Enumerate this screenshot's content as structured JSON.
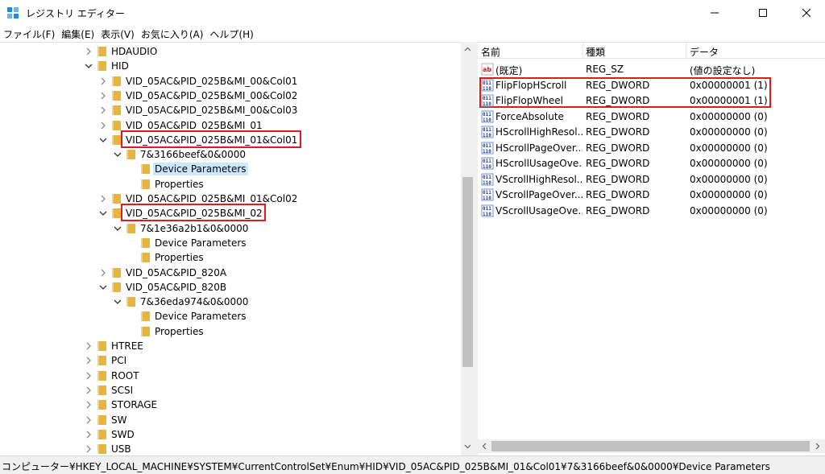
{
  "window": {
    "title": "レジストリ エディター",
    "icon": "registry-editor-icon"
  },
  "menu": [
    "ファイル(F)",
    "編集(E)",
    "表示(V)",
    "お気に入り(A)",
    "ヘルプ(H)"
  ],
  "tree": [
    {
      "label": "HDAUDIO",
      "level": 0,
      "state": "collapsed"
    },
    {
      "label": "HID",
      "level": 0,
      "state": "expanded"
    },
    {
      "label": "VID_05AC&PID_025B&MI_00&Col01",
      "level": 1,
      "state": "collapsed"
    },
    {
      "label": "VID_05AC&PID_025B&MI_00&Col02",
      "level": 1,
      "state": "collapsed"
    },
    {
      "label": "VID_05AC&PID_025B&MI_00&Col03",
      "level": 1,
      "state": "collapsed"
    },
    {
      "label": "VID_05AC&PID_025B&MI_01",
      "level": 1,
      "state": "collapsed"
    },
    {
      "label": "VID_05AC&PID_025B&MI_01&Col01",
      "level": 1,
      "state": "expanded",
      "highlight": true
    },
    {
      "label": "7&3166beef&0&0000",
      "level": 2,
      "state": "expanded"
    },
    {
      "label": "Device Parameters",
      "level": 3,
      "state": "none",
      "selected": true
    },
    {
      "label": "Properties",
      "level": 3,
      "state": "none"
    },
    {
      "label": "VID_05AC&PID_025B&MI_01&Col02",
      "level": 1,
      "state": "collapsed"
    },
    {
      "label": "VID_05AC&PID_025B&MI_02",
      "level": 1,
      "state": "expanded",
      "highlight": true
    },
    {
      "label": "7&1e36a2b1&0&0000",
      "level": 2,
      "state": "expanded"
    },
    {
      "label": "Device Parameters",
      "level": 3,
      "state": "none"
    },
    {
      "label": "Properties",
      "level": 3,
      "state": "none"
    },
    {
      "label": "VID_05AC&PID_820A",
      "level": 1,
      "state": "collapsed"
    },
    {
      "label": "VID_05AC&PID_820B",
      "level": 1,
      "state": "expanded"
    },
    {
      "label": "7&36eda974&0&0000",
      "level": 2,
      "state": "expanded"
    },
    {
      "label": "Device Parameters",
      "level": 3,
      "state": "none"
    },
    {
      "label": "Properties",
      "level": 3,
      "state": "none"
    },
    {
      "label": "HTREE",
      "level": 0,
      "state": "collapsed"
    },
    {
      "label": "PCI",
      "level": 0,
      "state": "collapsed"
    },
    {
      "label": "ROOT",
      "level": 0,
      "state": "collapsed"
    },
    {
      "label": "SCSI",
      "level": 0,
      "state": "collapsed"
    },
    {
      "label": "STORAGE",
      "level": 0,
      "state": "collapsed"
    },
    {
      "label": "SW",
      "level": 0,
      "state": "collapsed"
    },
    {
      "label": "SWD",
      "level": 0,
      "state": "collapsed"
    },
    {
      "label": "USB",
      "level": 0,
      "state": "collapsed"
    }
  ],
  "list": {
    "columns": [
      "名前",
      "種類",
      "データ"
    ],
    "rows": [
      {
        "name": "(既定)",
        "type": "REG_SZ",
        "data": "(値の設定なし)",
        "icon": "string-value-icon"
      },
      {
        "name": "FlipFlopHScroll",
        "type": "REG_DWORD",
        "data": "0x00000001 (1)",
        "icon": "dword-value-icon"
      },
      {
        "name": "FlipFlopWheel",
        "type": "REG_DWORD",
        "data": "0x00000001 (1)",
        "icon": "dword-value-icon"
      },
      {
        "name": "ForceAbsolute",
        "type": "REG_DWORD",
        "data": "0x00000000 (0)",
        "icon": "dword-value-icon"
      },
      {
        "name": "HScrollHighResol...",
        "type": "REG_DWORD",
        "data": "0x00000000 (0)",
        "icon": "dword-value-icon"
      },
      {
        "name": "HScrollPageOver...",
        "type": "REG_DWORD",
        "data": "0x00000000 (0)",
        "icon": "dword-value-icon"
      },
      {
        "name": "HScrollUsageOve...",
        "type": "REG_DWORD",
        "data": "0x00000000 (0)",
        "icon": "dword-value-icon"
      },
      {
        "name": "VScrollHighResol...",
        "type": "REG_DWORD",
        "data": "0x00000000 (0)",
        "icon": "dword-value-icon"
      },
      {
        "name": "VScrollPageOver...",
        "type": "REG_DWORD",
        "data": "0x00000000 (0)",
        "icon": "dword-value-icon"
      },
      {
        "name": "VScrollUsageOve...",
        "type": "REG_DWORD",
        "data": "0x00000000 (0)",
        "icon": "dword-value-icon"
      }
    ]
  },
  "status": "コンピューター¥HKEY_LOCAL_MACHINE¥SYSTEM¥CurrentControlSet¥Enum¥HID¥VID_05AC&PID_025B&MI_01&Col01¥7&3166beef&0&0000¥Device Parameters",
  "colors": {
    "highlight_border": "#e01b1b",
    "selection": "#cce8ff",
    "folder": "#e8b440"
  }
}
